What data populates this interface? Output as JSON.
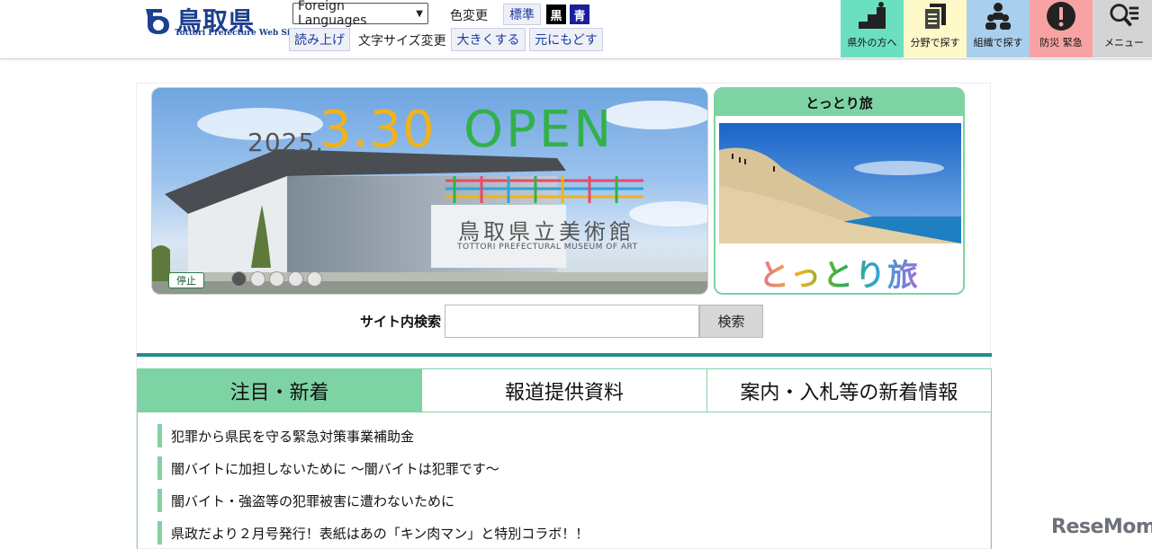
{
  "header": {
    "logo_title": "鳥取県",
    "logo_subtitle": "Tottori Prefecture Web Site",
    "language_select": "Foreign Languages",
    "color_change_label": "色変更",
    "color_standard": "標準",
    "color_black": "黒",
    "color_blue": "青",
    "read_aloud": "読み上げ",
    "text_size_label": "文字サイズ変更",
    "text_larger": "大きくする",
    "text_reset": "元にもどす",
    "nav": [
      {
        "label": "県外の方へ",
        "color": "#6be0c0",
        "icon": "stairs-icon"
      },
      {
        "label": "分野で探す",
        "color": "#fff8c8",
        "icon": "documents-icon"
      },
      {
        "label": "組織で探す",
        "color": "#a9cfee",
        "icon": "people-icon"
      },
      {
        "label": "防災 緊急",
        "color": "#f7a3a3",
        "icon": "alert-icon"
      },
      {
        "label": "メニュー",
        "color": "#d4d4d4",
        "icon": "menu-search-icon"
      }
    ]
  },
  "banner": {
    "year": "2025.",
    "date": "3.30",
    "open": "OPEN",
    "museum_name": "鳥取県立美術館",
    "museum_en": "TOTTORI PREFECTURAL MUSEUM OF ART",
    "stop_label": "停止",
    "slide_count": 5,
    "active_slide": 1
  },
  "travel": {
    "title": "とっとり旅",
    "logo_text": "とっとり旅"
  },
  "search": {
    "label": "サイト内検索",
    "value": "",
    "button": "検索"
  },
  "tabs": [
    {
      "label": "注目・新着",
      "active": true
    },
    {
      "label": "報道提供資料",
      "active": false
    },
    {
      "label": "案内・入札等の新着情報",
      "active": false
    }
  ],
  "news": [
    "犯罪から県民を守る緊急対策事業補助金",
    "闇バイトに加担しないために ～闇バイトは犯罪です～",
    "闇バイト・強盗等の犯罪被害に遭わないために",
    "県政だより２月号発行！表紙はあの「キン肉マン」と特別コラボ！！"
  ],
  "watermark": "ReseMom"
}
